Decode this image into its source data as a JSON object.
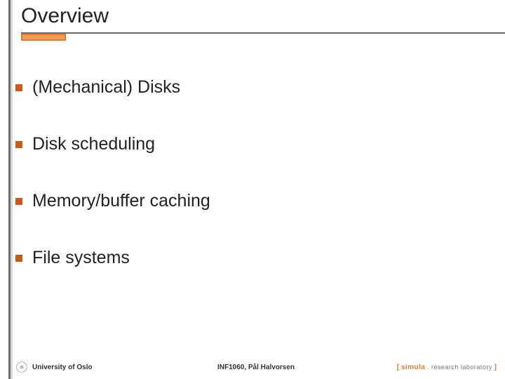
{
  "title": "Overview",
  "bullets": [
    "(Mechanical) Disks",
    "Disk scheduling",
    "Memory/buffer caching",
    "File systems"
  ],
  "footer": {
    "left": "University of Oslo",
    "center": "INF1060, Pål Halvorsen",
    "right": {
      "open": "[ ",
      "brand": "simula",
      "dot": " . ",
      "rest": "research laboratory",
      "close": " ]"
    }
  }
}
